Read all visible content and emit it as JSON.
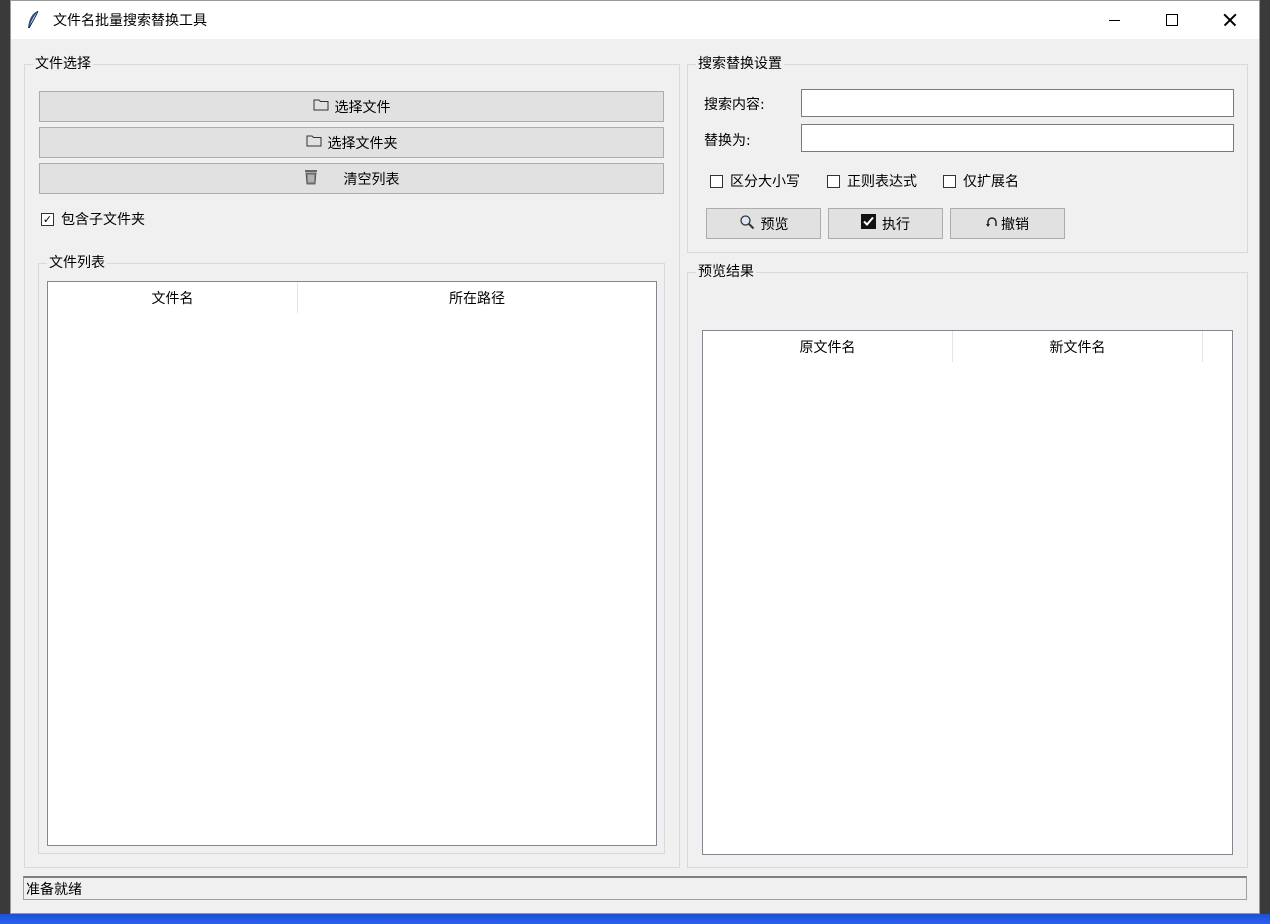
{
  "window": {
    "title": "文件名批量搜索替换工具"
  },
  "file_selection": {
    "legend": "文件选择",
    "select_files_label": "选择文件",
    "select_folder_label": "选择文件夹",
    "clear_list_label": "清空列表",
    "include_subfolders_label": "包含子文件夹",
    "include_subfolders_checked": true
  },
  "file_list": {
    "legend": "文件列表",
    "columns": [
      "文件名",
      "所在路径"
    ],
    "rows": []
  },
  "search_settings": {
    "legend": "搜索替换设置",
    "search_label": "搜索内容:",
    "search_value": "",
    "replace_label": "替换为:",
    "replace_value": "",
    "case_sensitive_label": "区分大小写",
    "regex_label": "正则表达式",
    "ext_only_label": "仅扩展名",
    "preview_label": "预览",
    "execute_label": "执行",
    "undo_label": "撤销"
  },
  "preview_results": {
    "legend": "预览结果",
    "columns": [
      "原文件名",
      "新文件名"
    ],
    "rows": []
  },
  "status": {
    "text": "准备就绪"
  }
}
